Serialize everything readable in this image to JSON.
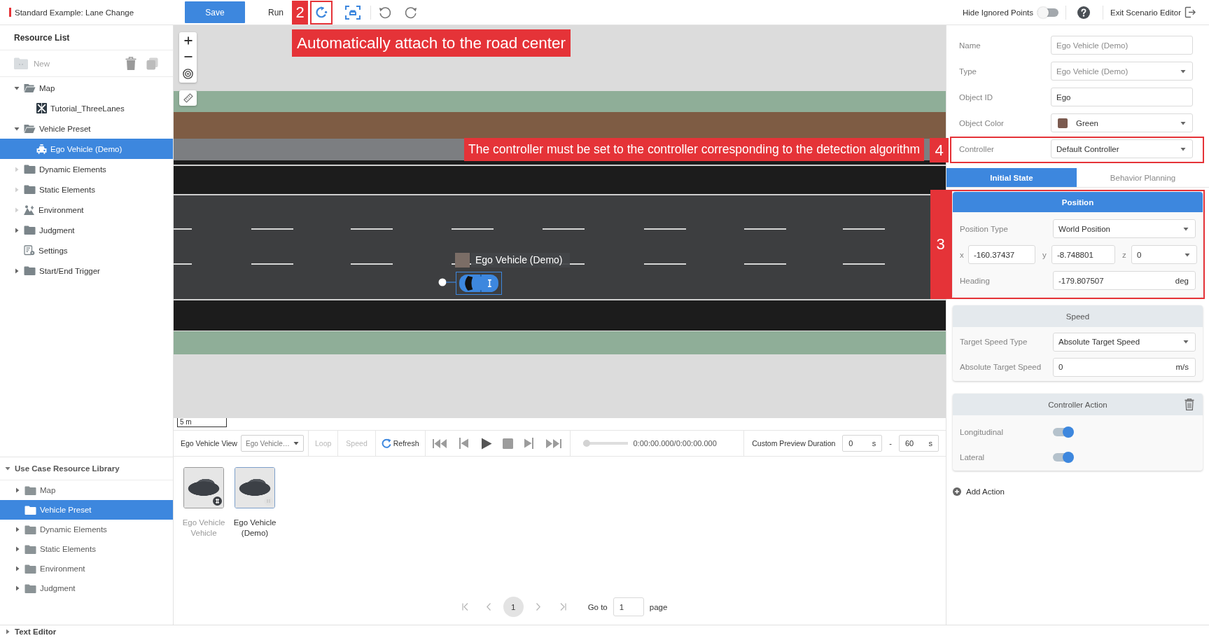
{
  "top_bar": {
    "title": "Standard Example: Lane Change",
    "save_label": "Save",
    "run_label": "Run",
    "attach_callout": {
      "number": "2",
      "note": "Automatically attach to the road center"
    },
    "hide_ignored_points": {
      "label": "Hide Ignored Points",
      "on": false
    },
    "exit_label": "Exit Scenario Editor"
  },
  "resource_list": {
    "title": "Resource List",
    "new_button": {
      "label": "New",
      "disabled": true
    },
    "items": [
      {
        "label": "Map",
        "kind": "folder",
        "selected": false,
        "expanded": true,
        "empty": false,
        "children": [
          {
            "label": "Tutorial_ThreeLanes",
            "kind": "map",
            "selected": false
          }
        ]
      },
      {
        "label": "Vehicle Preset",
        "kind": "folder",
        "selected": false,
        "expanded": true,
        "empty": false,
        "children": [
          {
            "label": "Ego Vehicle (Demo)",
            "kind": "vehicle",
            "selected": true
          }
        ]
      },
      {
        "label": "Dynamic Elements",
        "kind": "folder",
        "selected": false,
        "expanded": false,
        "empty": true
      },
      {
        "label": "Static Elements",
        "kind": "folder",
        "selected": false,
        "expanded": false,
        "empty": true
      },
      {
        "label": "Environment",
        "kind": "environment",
        "selected": false,
        "expanded": false,
        "empty": true
      },
      {
        "label": "Judgment",
        "kind": "folder",
        "selected": false,
        "expanded": false,
        "empty": false
      },
      {
        "label": "Settings",
        "kind": "settings",
        "selected": false
      },
      {
        "label": "Start/End Trigger",
        "kind": "folder",
        "selected": false,
        "expanded": false,
        "empty": false
      }
    ]
  },
  "library": {
    "title": "Use Case Resource Library",
    "expanded": true,
    "items": [
      {
        "label": "Map",
        "selected": false,
        "expanded": false
      },
      {
        "label": "Vehicle Preset",
        "selected": true
      },
      {
        "label": "Dynamic Elements",
        "selected": false,
        "expanded": false
      },
      {
        "label": "Static Elements",
        "selected": false,
        "expanded": false
      },
      {
        "label": "Environment",
        "selected": false,
        "expanded": false
      },
      {
        "label": "Judgment",
        "selected": false,
        "expanded": false
      }
    ]
  },
  "text_editor": {
    "label": "Text Editor",
    "expanded": false
  },
  "canvas": {
    "vehicle_label": "Ego Vehicle (Demo)",
    "scale_label": "5 m"
  },
  "preview_bar": {
    "view_label": "Ego Vehicle View",
    "view_value": "Ego Vehicle…",
    "loop": {
      "label": "Loop",
      "disabled": true
    },
    "speed": {
      "label": "Speed",
      "disabled": true
    },
    "refresh_label": "Refresh",
    "progress": {
      "level": 0
    },
    "time": "0:00:00.000/0:00:00.000",
    "duration_label": "Custom Preview Duration",
    "duration_start": {
      "value": "0",
      "unit": "s"
    },
    "range_separator": "-",
    "duration_end": {
      "value": "60",
      "unit": "s"
    }
  },
  "assets": [
    {
      "name": "Ego Vehicle Vehicle",
      "selected": false
    },
    {
      "name": "Ego Vehicle (Demo)",
      "selected": true
    }
  ],
  "pagination": {
    "pages": [
      {
        "label": "1",
        "selected": true
      }
    ],
    "goto_label": "Go to",
    "goto_value": "1",
    "page_label": "page"
  },
  "properties": {
    "fields": [
      {
        "label": "Name",
        "kind": "text",
        "value": "Ego Vehicle (Demo)",
        "disabled": true
      },
      {
        "label": "Type",
        "kind": "select",
        "value": "Ego Vehicle (Demo)",
        "disabled": true
      },
      {
        "label": "Object ID",
        "kind": "text",
        "value": "Ego",
        "disabled": false
      },
      {
        "label": "Object Color",
        "kind": "color",
        "value": "Green",
        "color": "#7b5a4f",
        "disabled": false
      },
      {
        "label": "Controller",
        "kind": "select",
        "value": "Default Controller",
        "disabled": false,
        "callout": {
          "number": "4",
          "note": "The controller must be set to the controller corresponding to the detection algorithm"
        }
      }
    ],
    "tabs": [
      {
        "label": "Initial State",
        "selected": true
      },
      {
        "label": "Behavior Planning",
        "selected": false
      }
    ],
    "cards": [
      {
        "kind": "position",
        "title": "Position",
        "selected": true,
        "callout": {
          "number": "3"
        },
        "type_label": "Position Type",
        "type_value": "World Position",
        "coords": [
          {
            "label": "x",
            "value": "-160.37437",
            "kind": "input"
          },
          {
            "label": "y",
            "value": "-8.748801",
            "kind": "input"
          },
          {
            "label": "z",
            "value": "0",
            "kind": "select"
          }
        ],
        "heading": {
          "label": "Heading",
          "value": "-179.807507",
          "unit": "deg"
        }
      },
      {
        "kind": "speed",
        "title": "Speed",
        "selected": false,
        "type_label": "Target Speed Type",
        "type_value": "Absolute Target Speed",
        "speed": {
          "label": "Absolute Target Speed",
          "value": "0",
          "unit": "m/s"
        }
      },
      {
        "kind": "controller_action",
        "title": "Controller Action",
        "selected": false,
        "toggles": [
          {
            "label": "Longitudinal",
            "on": true
          },
          {
            "label": "Lateral",
            "on": true
          }
        ]
      }
    ],
    "add_action_label": "Add Action"
  }
}
